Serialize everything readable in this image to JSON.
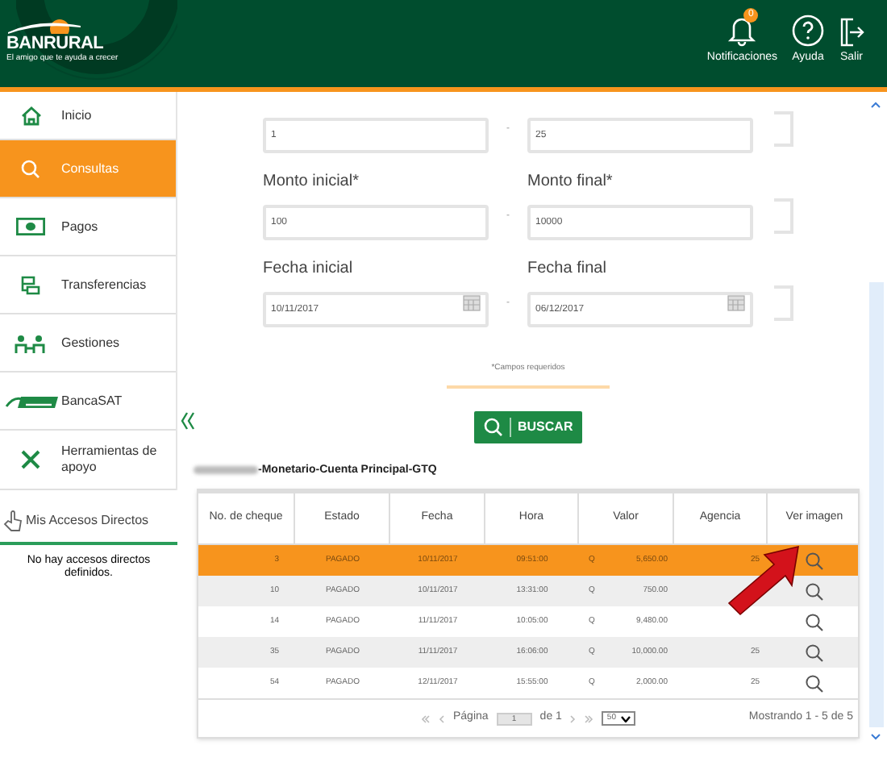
{
  "header": {
    "logo": {
      "name": "BANRURAL",
      "tagline": "El amigo que te ayuda a crecer"
    },
    "actions": [
      {
        "kind": "bell",
        "label": "Notificaciones",
        "badge": "0"
      },
      {
        "kind": "help",
        "label": "Ayuda"
      },
      {
        "kind": "exit",
        "label": "Salir"
      }
    ]
  },
  "sidebar": {
    "items": [
      {
        "kind": "home",
        "label": "Inicio",
        "selected": false
      },
      {
        "kind": "search",
        "label": "Consultas",
        "selected": true
      },
      {
        "kind": "money",
        "label": "Pagos",
        "selected": false
      },
      {
        "kind": "transfer",
        "label": "Transferencias",
        "selected": false
      },
      {
        "kind": "people",
        "label": "Gestiones",
        "selected": false
      },
      {
        "kind": "sat",
        "label": "BancaSAT",
        "selected": false
      },
      {
        "kind": "tools",
        "label": "Herramientas de apoyo",
        "selected": false
      }
    ],
    "shortcuts": {
      "title": "Mis Accesos Directos",
      "empty_message": "No hay accesos directos definidos."
    }
  },
  "form": {
    "rows": [
      {
        "left": {
          "kind": "text",
          "value": "1"
        },
        "right": {
          "kind": "text",
          "value": "25"
        }
      },
      {
        "left_label": "Monto inicial*",
        "right_label": "Monto final*",
        "left": {
          "kind": "text",
          "value": "100"
        },
        "right": {
          "kind": "text",
          "value": "10000"
        }
      },
      {
        "left_label": "Fecha inicial",
        "right_label": "Fecha final",
        "left": {
          "kind": "date",
          "value": "10/11/2017"
        },
        "right": {
          "kind": "date",
          "value": "06/12/2017"
        }
      }
    ],
    "separator": "-",
    "note": "*Campos requeridos",
    "button": "BUSCAR"
  },
  "account_title": "-Monetario-Cuenta Principal-GTQ",
  "table": {
    "columns": [
      "No. de cheque",
      "Estado",
      "Fecha",
      "Hora",
      "Valor",
      "Agencia",
      "Ver imagen"
    ],
    "rows": [
      {
        "cheque": "3",
        "estado": "PAGADO",
        "fecha": "10/11/2017",
        "hora": "09:51:00",
        "currency": "Q",
        "valor": "5,650.00",
        "agencia": "25",
        "selected": true
      },
      {
        "cheque": "10",
        "estado": "PAGADO",
        "fecha": "10/11/2017",
        "hora": "13:31:00",
        "currency": "Q",
        "valor": "750.00",
        "selected": false
      },
      {
        "cheque": "14",
        "estado": "PAGADO",
        "fecha": "11/11/2017",
        "hora": "10:05:00",
        "currency": "Q",
        "valor": "9,480.00",
        "selected": false
      },
      {
        "cheque": "35",
        "estado": "PAGADO",
        "fecha": "11/11/2017",
        "hora": "16:06:00",
        "currency": "Q",
        "valor": "10,000.00",
        "agencia": "25",
        "selected": false
      },
      {
        "cheque": "54",
        "estado": "PAGADO",
        "fecha": "12/11/2017",
        "hora": "15:55:00",
        "currency": "Q",
        "valor": "2,000.00",
        "agencia": "25",
        "selected": false
      }
    ]
  },
  "pager": {
    "page_label": "Página",
    "page": "1",
    "of": "de 1",
    "page_size": "50",
    "summary": "Mostrando 1 - 5 de 5"
  }
}
